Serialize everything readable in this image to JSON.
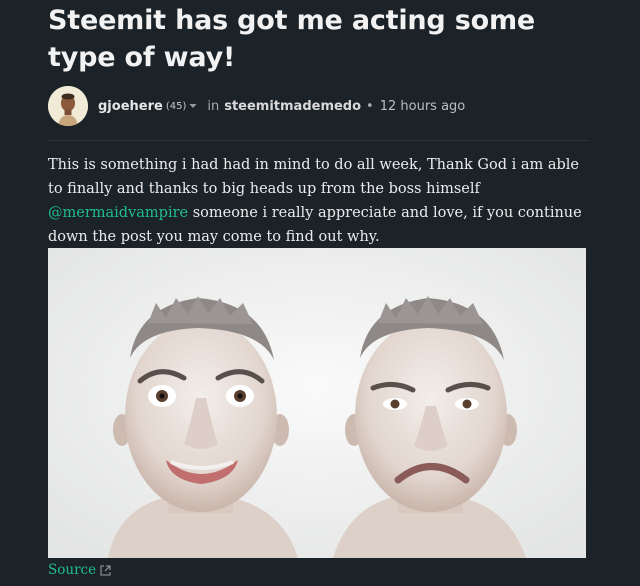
{
  "post": {
    "title": "Steemit has got me acting some type of way!",
    "author": {
      "name": "gjoehere",
      "reputation": "(45)",
      "avatar_icon": "user-avatar"
    },
    "in_label": "in",
    "community": "steemitmademedo",
    "separator": "•",
    "timestamp": "12 hours ago",
    "body": {
      "para_start": "This is something i had had in mind to do all week, Thank God i am able to finally and thanks to big heads up from the boss himself ",
      "mention": "@mermaidvampire",
      "para_end": " someone i really appreciate and love, if you continue down the post you may come to find out why."
    },
    "image": {
      "alt": "Two faces side by side: one smiling, one frowning"
    },
    "source_label": "Source",
    "colors": {
      "background": "#1b2228",
      "accent": "#1fbf8f",
      "text": "#ececec"
    }
  }
}
